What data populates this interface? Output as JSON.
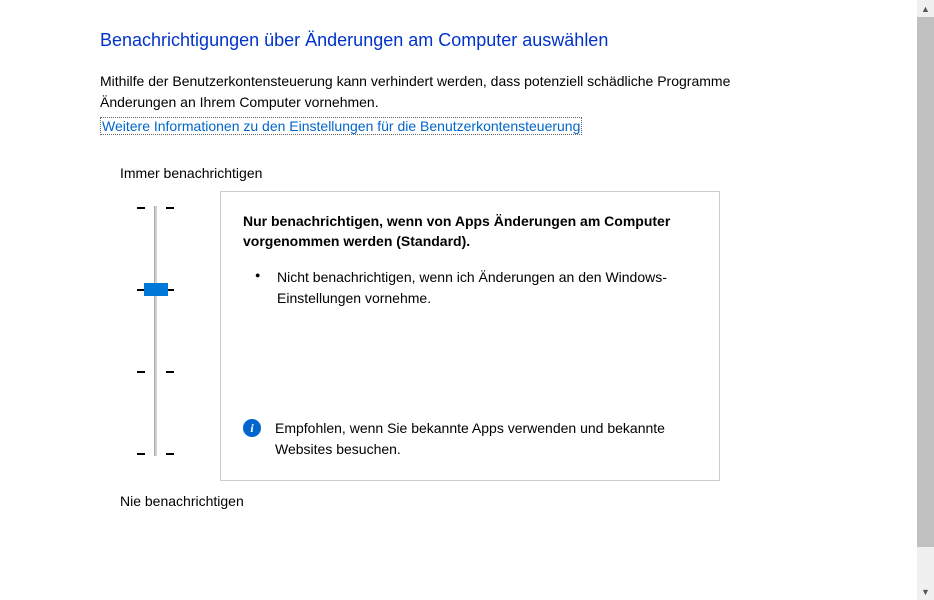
{
  "title": "Benachrichtigungen über Änderungen am Computer auswählen",
  "description": "Mithilfe der Benutzerkontensteuerung kann verhindert werden, dass potenziell schädliche Programme Änderungen an Ihrem Computer vornehmen.",
  "help_link": "Weitere Informationen zu den Einstellungen für die Benutzerkontensteuerung",
  "slider": {
    "top_label": "Immer benachrichtigen",
    "bottom_label": "Nie benachrichtigen",
    "levels": 4,
    "current_level": 2
  },
  "panel": {
    "heading": "Nur benachrichtigen, wenn von Apps Änderungen am Computer vorgenommen werden (Standard).",
    "bullet": "Nicht benachrichtigen, wenn ich Änderungen an den Windows-Einstellungen vornehme.",
    "recommendation": "Empfohlen, wenn Sie bekannte Apps verwenden und bekannte Websites besuchen."
  },
  "info_icon_glyph": "i"
}
